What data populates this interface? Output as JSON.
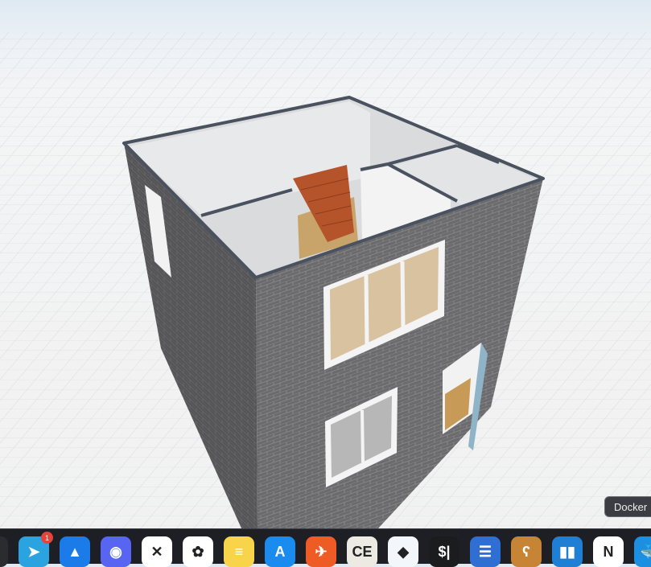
{
  "tooltip": {
    "label": "Docker"
  },
  "dock": {
    "items": [
      {
        "name": "partial-app",
        "glyph": "",
        "color": "#2a2c30"
      },
      {
        "name": "telegram",
        "glyph": "➤",
        "color": "#2aa3e0",
        "badge": "1"
      },
      {
        "name": "spark",
        "glyph": "▲",
        "color": "#1b7be8"
      },
      {
        "name": "discord",
        "glyph": "◉",
        "color": "#5865f2"
      },
      {
        "name": "capcut",
        "glyph": "✕",
        "color": "#ffffff"
      },
      {
        "name": "photos",
        "glyph": "✿",
        "color": "#ffffff"
      },
      {
        "name": "notes",
        "glyph": "≡",
        "color": "#f7d44a"
      },
      {
        "name": "app-store",
        "glyph": "A",
        "color": "#1a8cf0"
      },
      {
        "name": "postman",
        "glyph": "✈",
        "color": "#ef5b25"
      },
      {
        "name": "dbeaver",
        "glyph": "CE",
        "color": "#ede9e3"
      },
      {
        "name": "postgres-elephant",
        "glyph": "◆",
        "color": "#f3f6fa"
      },
      {
        "name": "terminal",
        "glyph": "$|",
        "color": "#1b1c1e"
      },
      {
        "name": "blue-window-app",
        "glyph": "☰",
        "color": "#2f6fd3"
      },
      {
        "name": "tunnelbear",
        "glyph": "ʕ",
        "color": "#c68434"
      },
      {
        "name": "trello",
        "glyph": "▮▮",
        "color": "#1f7fd4"
      },
      {
        "name": "notion",
        "glyph": "N",
        "color": "#ffffff"
      },
      {
        "name": "docker",
        "glyph": "🐳",
        "color": "#1d8fe1"
      }
    ]
  }
}
